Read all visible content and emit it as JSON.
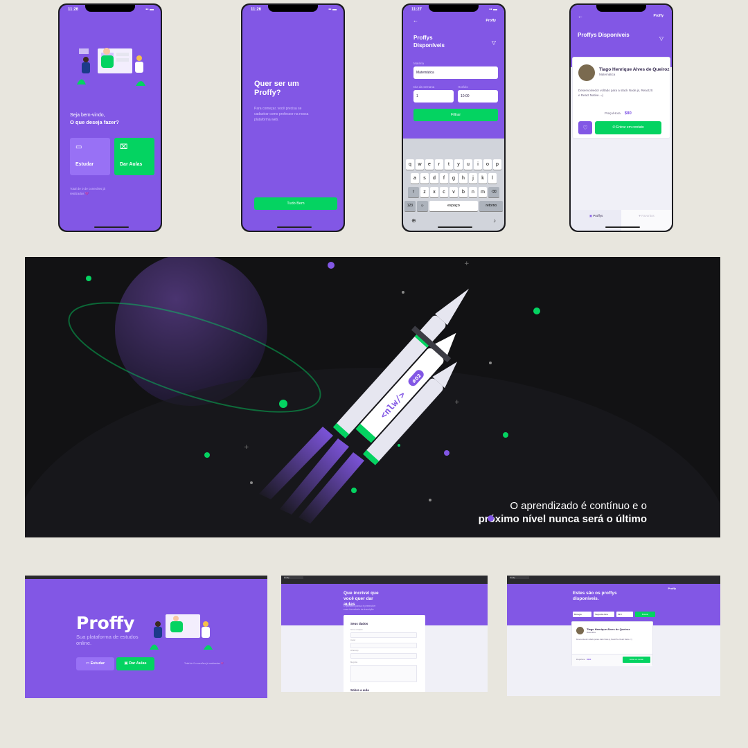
{
  "colors": {
    "brand_purple": "#8257e5",
    "light_purple": "#9871f5",
    "green": "#04d361",
    "background": "#e8e6de",
    "banner_bg": "#121214"
  },
  "phone1": {
    "time": "11:26",
    "welcome_line1": "Seja bem-vindo,",
    "welcome_line2": "O que deseja fazer?",
    "study_label": "Estudar",
    "teach_label": "Dar Aulas",
    "study_icon": "book-icon",
    "teach_icon": "whiteboard-icon",
    "total_connections": "Total de 0 de conexões já realizadas 💜"
  },
  "phone2": {
    "time": "11:26",
    "title": "Quer ser um Proffy?",
    "description": "Para começar, você precisa se cadastrar como professor na nossa plataforma web.",
    "button_label": "Tudo Bem"
  },
  "phone3": {
    "time": "11:27",
    "brand": "Proffy",
    "title": "Proffys Disponíveis",
    "subject_label": "Matéria",
    "subject_value": "Matemática",
    "weekday_label": "Dia da semana",
    "weekday_value": "1",
    "time_label": "Horário",
    "time_value": "10:00",
    "filter_button": "Filtrar",
    "keyboard": {
      "row1": [
        "q",
        "w",
        "e",
        "r",
        "t",
        "y",
        "u",
        "i",
        "o",
        "p"
      ],
      "row2": [
        "a",
        "s",
        "d",
        "f",
        "g",
        "h",
        "j",
        "k",
        "l"
      ],
      "row3": [
        "z",
        "x",
        "c",
        "v",
        "b",
        "n",
        "m"
      ],
      "numbers_key": "123",
      "space_key": "espaço",
      "return_key": "retorno"
    }
  },
  "phone4": {
    "brand": "Proffy",
    "title": "Proffys Disponíveis",
    "teacher_name": "Tiago Henrique Alves de Queiroz",
    "teacher_subject": "Matemática",
    "teacher_bio": "Desenvolvedor voltado para a stack Node.js, ReactJS e React Native. =)",
    "price_label": "Preço/Hora",
    "price_value": "$80",
    "contact_button": "Entrar em contato",
    "tab_proffys": "Proffys",
    "tab_favorites": "Favoritos"
  },
  "banner": {
    "badge_text": "<nlw/>",
    "badge_number": "#02",
    "caption_line1": "O aprendizado é contínuo e o",
    "caption_line2": "próximo nível nunca será o último"
  },
  "web1": {
    "logo": "Proffy",
    "tagline": "Sua plataforma de estudos online.",
    "study_label": "Estudar",
    "teach_label": "Dar Aulas",
    "total_connections": "Total de 0 conexões já realizadas 💜"
  },
  "web2": {
    "tab_title": "Proffy",
    "title": "Que incrível que você quer dar aulas",
    "subtitle": "O primeiro passo é preencher esse formulário de inscrição",
    "form_title": "Seus dados",
    "field1": "Nome completo",
    "field2": "Avatar",
    "field3": "WhatsApp",
    "field4": "Biografia",
    "section2": "Sobre a aula"
  },
  "web3": {
    "tab_title": "Proffy",
    "brand": "Proffy",
    "title": "Estes são os proffys disponíveis.",
    "subject_value": "Biologia",
    "weekday_value": "Segunda-feira",
    "time_value": "09:0",
    "search_button": "Buscar",
    "teacher_name": "Tiago Henrique Alves de Queiroz",
    "teacher_subject": "Matemática",
    "teacher_bio": "Desenvolvedor voltado para a stack Node.js, ReactJS e React Native. =)",
    "price_label": "Preço/hora",
    "price_value": "R$80",
    "contact_button": "Entrar em contato"
  }
}
